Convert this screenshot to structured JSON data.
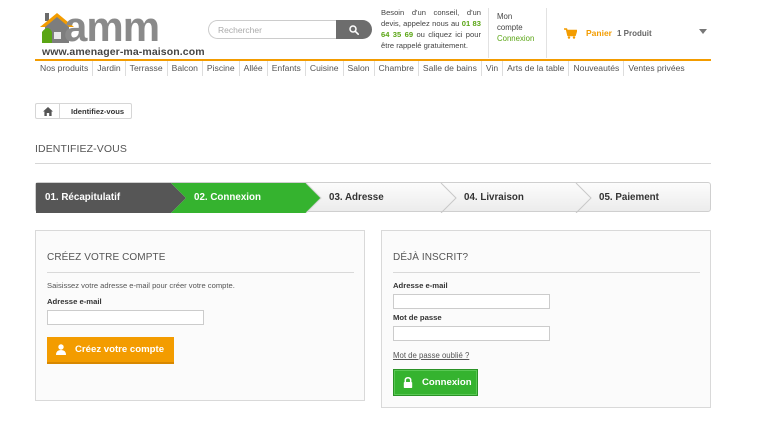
{
  "header": {
    "logo_text": "amm",
    "logo_site": "www.amenager-ma-maison.com",
    "search": {
      "placeholder": "Rechercher"
    },
    "advice": {
      "text_before": "Besoin d'un conseil, d'un devis, appelez nous au ",
      "phone": "01 83 64 35 69",
      "text_after": " ou cliquez ici pour être rappelé gratuitement."
    },
    "account": {
      "line1": "Mon",
      "line2": "compte",
      "login": "Connexion"
    },
    "cart": {
      "label": "Panier",
      "count": "1 Produit"
    }
  },
  "nav": {
    "items": [
      "Nos produits",
      "Jardin",
      "Terrasse",
      "Balcon",
      "Piscine",
      "Allée",
      "Enfants",
      "Cuisine",
      "Salon",
      "Chambre",
      "Salle de bains",
      "Vin",
      "Arts de la table",
      "Nouveautés",
      "Ventes privées"
    ]
  },
  "breadcrumb": {
    "current": "Identifiez-vous"
  },
  "page_title": "Identifiez-vous",
  "steps": [
    {
      "label": "01. Récapitulatif",
      "state": "done"
    },
    {
      "label": "02. Connexion",
      "state": "active"
    },
    {
      "label": "03. Adresse",
      "state": "todo"
    },
    {
      "label": "04. Livraison",
      "state": "todo"
    },
    {
      "label": "05. Paiement",
      "state": "todo"
    }
  ],
  "create_account": {
    "title": "Créez votre compte",
    "hint": "Saisissez votre adresse e-mail pour créer votre compte.",
    "email_label": "Adresse e-mail",
    "email_value": "",
    "button": "Créez votre compte"
  },
  "login": {
    "title": "Déjà inscrit?",
    "email_label": "Adresse e-mail",
    "email_value": "",
    "password_label": "Mot de passe",
    "password_value": "",
    "forgot": "Mot de passe oublié ?",
    "button": "Connexion"
  },
  "colors": {
    "accent_orange": "#f39c00",
    "accent_green": "#35b32f",
    "step_done": "#565656",
    "link_green": "#5aa514"
  }
}
